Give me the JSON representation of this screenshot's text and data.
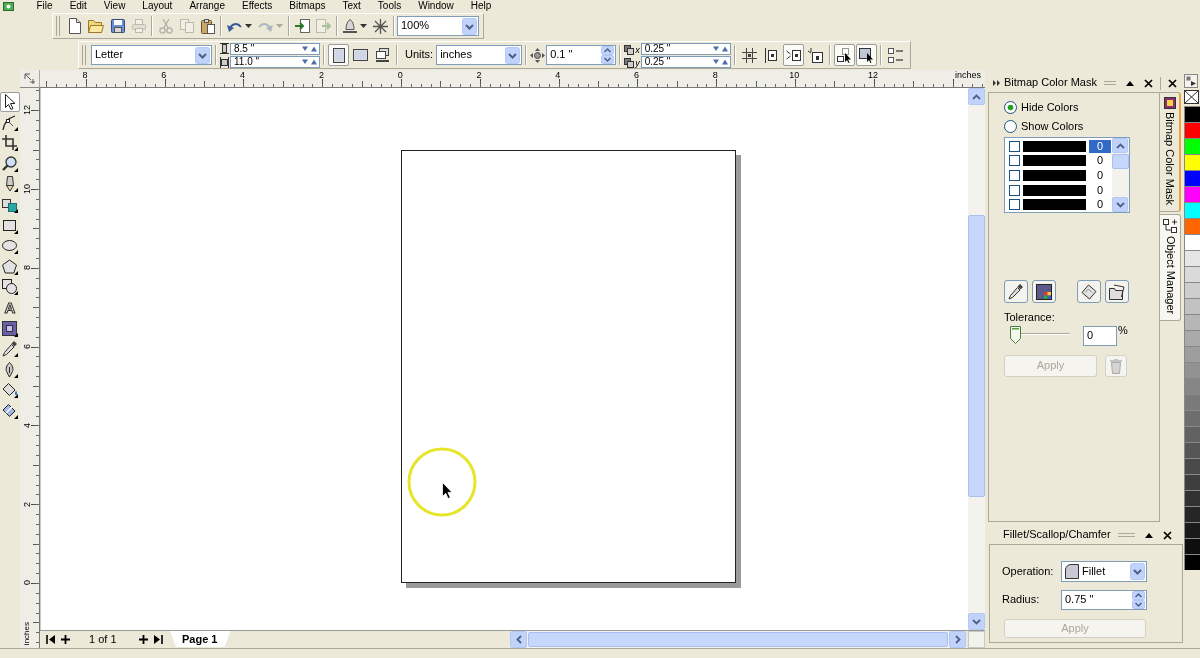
{
  "menu_bar": [
    "File",
    "Edit",
    "View",
    "Layout",
    "Arrange",
    "Effects",
    "Bitmaps",
    "Text",
    "Tools",
    "Window",
    "Help"
  ],
  "standard_toolbar": {
    "buttons": [
      {
        "disabled": false,
        "dropdown": false
      },
      {
        "disabled": false,
        "dropdown": false
      },
      {
        "disabled": false,
        "dropdown": false
      },
      {
        "disabled": true,
        "dropdown": false
      },
      {
        "disabled": true,
        "dropdown": false
      },
      {
        "disabled": true,
        "dropdown": false
      },
      {
        "disabled": false,
        "dropdown": false
      },
      {
        "disabled": false,
        "dropdown": true
      },
      {
        "disabled": true,
        "dropdown": true
      },
      {
        "disabled": false,
        "dropdown": false
      },
      {
        "disabled": true,
        "dropdown": false
      },
      {
        "disabled": false,
        "dropdown": true
      },
      {
        "disabled": false,
        "dropdown": false
      }
    ],
    "zoom_level": "100%"
  },
  "property_bar": {
    "paper_size": "Letter",
    "page_width": "8.5 \"",
    "page_height": "11.0 \"",
    "orientation": [
      {
        "selected": true
      },
      {
        "selected": false
      }
    ],
    "units_label": "Units:",
    "units": "inches",
    "nudge_distance": "0.1 \"",
    "duplicate_distance": [
      {
        "axis": "x",
        "value": "0.25 \""
      },
      {
        "axis": "y",
        "value": "0.25 \""
      }
    ],
    "snap_toggles": [
      {
        "on": false
      },
      {
        "on": false
      },
      {
        "on": true
      },
      {
        "on": false
      },
      {
        "on": true
      },
      {
        "on": true
      }
    ]
  },
  "toolbox": [
    {
      "selected": true
    },
    {
      "selected": false
    },
    {
      "selected": false
    },
    {
      "selected": false
    },
    {
      "selected": false
    },
    {
      "selected": false
    },
    {
      "selected": false
    },
    {
      "selected": false
    },
    {
      "selected": false
    },
    {
      "selected": false
    },
    {
      "selected": false,
      "glyph": "A"
    },
    {
      "selected": false
    },
    {
      "selected": false
    },
    {
      "selected": false
    },
    {
      "selected": false
    },
    {
      "selected": false
    }
  ],
  "horizontal_ruler": {
    "labels": [
      "8",
      "6",
      "4",
      "2",
      "0",
      "2",
      "4",
      "6",
      "8",
      "10",
      "12"
    ],
    "unit": "inches"
  },
  "vertical_ruler": {
    "labels": [
      "12",
      "10",
      "8",
      "6",
      "4",
      "2",
      "0"
    ],
    "unit": "inches"
  },
  "document": {
    "page_counter": "1 of 1",
    "page_tabs": [
      {
        "label": "Page 1",
        "selected": true
      }
    ]
  },
  "bitmap_color_mask": {
    "title": "Bitmap Color Mask",
    "modes": [
      {
        "label": "Hide Colors",
        "selected": true
      },
      {
        "label": "Show Colors",
        "selected": false
      }
    ],
    "colors": [
      {
        "checked": false,
        "color": "#000000",
        "value": "0",
        "selected": true
      },
      {
        "checked": false,
        "color": "#000000",
        "value": "0",
        "selected": false
      },
      {
        "checked": false,
        "color": "#000000",
        "value": "0",
        "selected": false
      },
      {
        "checked": false,
        "color": "#000000",
        "value": "0",
        "selected": false
      },
      {
        "checked": false,
        "color": "#000000",
        "value": "0",
        "selected": false
      }
    ],
    "tolerance_label": "Tolerance:",
    "tolerance": {
      "level": 0,
      "value": "0",
      "unit": "%"
    },
    "apply": {
      "label": "Apply",
      "disabled": true
    },
    "delete_button": {
      "disabled": true
    }
  },
  "docker_tabs": [
    {
      "label": "Bitmap Color Mask",
      "selected": true
    },
    {
      "label": "Object Manager",
      "selected": false
    }
  ],
  "fillet_scallop_chamfer": {
    "title": "Fillet/Scallop/Chamfer",
    "operation_label": "Operation:",
    "operation": "Fillet",
    "radius_label": "Radius:",
    "radius": "0.75 \"",
    "apply": {
      "label": "Apply",
      "disabled": true
    }
  },
  "color_palette": [
    {
      "color": "#000000"
    },
    {
      "color": "#ff0000"
    },
    {
      "color": "#00ff00"
    },
    {
      "color": "#ffff00"
    },
    {
      "color": "#0000ff"
    },
    {
      "color": "#ff00ff"
    },
    {
      "color": "#00ffff"
    },
    {
      "color": "#ff6600"
    },
    {
      "color": "#ffffff"
    },
    {
      "color": "#e6e6e6"
    },
    {
      "color": "#dadada"
    },
    {
      "color": "#cecece"
    },
    {
      "color": "#c2c2c2"
    },
    {
      "color": "#b6b6b6"
    },
    {
      "color": "#aaaaaa"
    },
    {
      "color": "#9e9e9e"
    },
    {
      "color": "#929292"
    },
    {
      "color": "#868686"
    },
    {
      "color": "#7a7a7a"
    },
    {
      "color": "#6e6e6e"
    },
    {
      "color": "#626262"
    },
    {
      "color": "#565656"
    },
    {
      "color": "#4a4a4a"
    },
    {
      "color": "#3e3e3e"
    },
    {
      "color": "#323232"
    },
    {
      "color": "#262626"
    },
    {
      "color": "#1a1a1a"
    },
    {
      "color": "#0e0e0e"
    },
    {
      "color": "#000000"
    }
  ]
}
